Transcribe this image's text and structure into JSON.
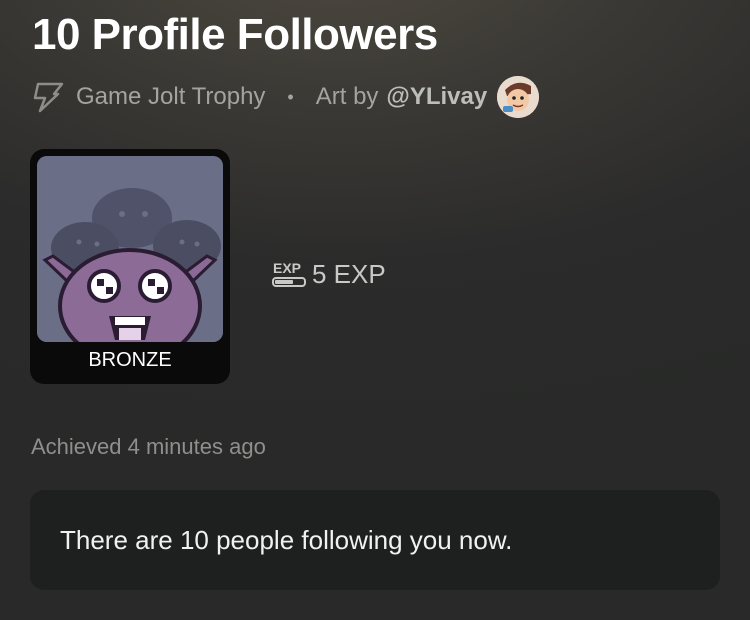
{
  "trophy": {
    "title": "10 Profile Followers",
    "type_label": "Game Jolt Trophy",
    "separator": "•",
    "art_by_label": "Art by",
    "artist": "@YLivay",
    "tier": "BRONZE",
    "exp_icon_text": "EXP",
    "exp_value": "5 EXP",
    "achieved": "Achieved 4 minutes ago",
    "description": "There are 10 people following you now."
  },
  "icons": {
    "type": "lightning-bolt-icon",
    "exp": "exp-icon",
    "avatar": "artist-avatar"
  },
  "colors": {
    "background": "#2b2b2b",
    "card": "#0a0a0a",
    "description_box": "#1e1f1f",
    "muted_text": "#a3a39f"
  }
}
